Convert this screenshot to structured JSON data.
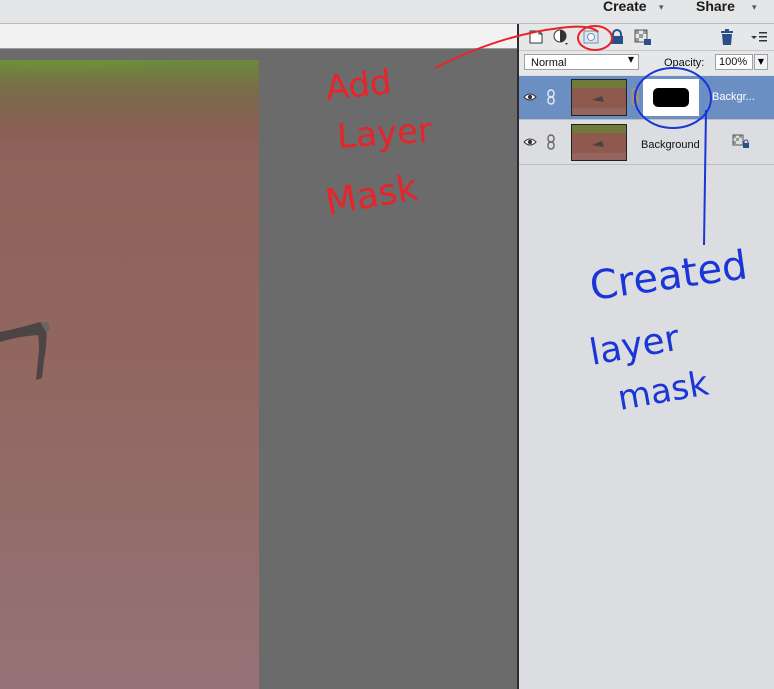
{
  "menu": {
    "create_label": "Create",
    "share_label": "Share"
  },
  "panel_toolbar": {
    "icons": [
      "new-layer-icon",
      "adjustment-layer-icon",
      "add-layer-mask-icon",
      "lock-all-icon",
      "lock-transparency-icon",
      "trash-icon",
      "panel-menu-icon"
    ]
  },
  "blend": {
    "mode": "Normal",
    "opacity_label": "Opacity:",
    "opacity_value": "100%"
  },
  "layers": [
    {
      "name": "Backgr...",
      "selected": true,
      "has_mask": true
    },
    {
      "name": "Background",
      "selected": false,
      "locked": true
    }
  ],
  "annotations": {
    "red_text": "Add Layer Mask",
    "blue_text": "Created layer mask",
    "red_color": "#e8242a",
    "blue_color": "#1a35d8"
  },
  "colors": {
    "selected_layer": "#6b8fc3",
    "panel_bg": "#dcdde0",
    "canvas_bg": "#6b6b6b"
  }
}
